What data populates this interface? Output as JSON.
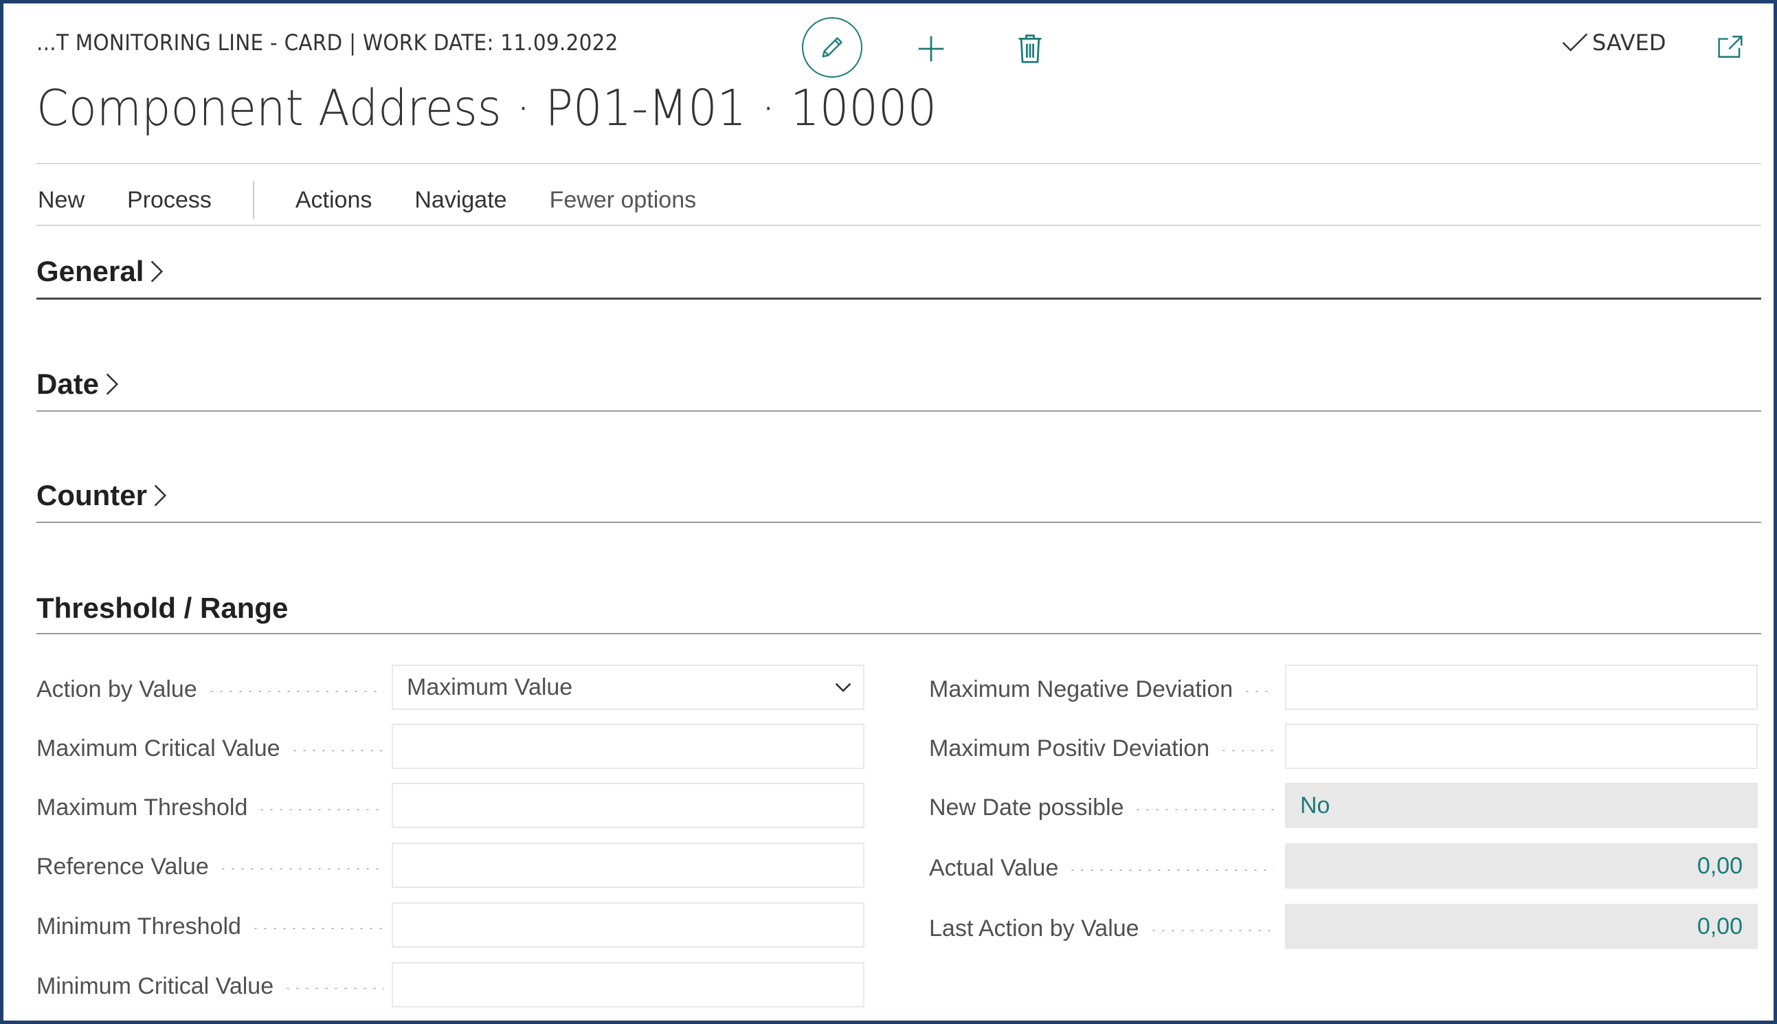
{
  "header": {
    "breadcrumb": "...T MONITORING LINE - CARD | WORK DATE: 11.09.2022",
    "title": "Component Address · P01-M01 · 10000",
    "saved_label": "SAVED"
  },
  "toolbar_icons": [
    "pencil-icon",
    "plus-icon",
    "trash-icon",
    "check-icon",
    "open-in-new-window-icon"
  ],
  "action_bar": {
    "items": [
      "New",
      "Process",
      "Actions",
      "Navigate",
      "Fewer options"
    ]
  },
  "sections": {
    "general": "General",
    "date": "Date",
    "counter": "Counter",
    "threshold": "Threshold / Range"
  },
  "threshold_left": [
    {
      "label": "Action by Value",
      "value": "Maximum Value"
    },
    {
      "label": "Maximum Critical Value",
      "value": ""
    },
    {
      "label": "Maximum Threshold",
      "value": ""
    },
    {
      "label": "Reference Value",
      "value": ""
    },
    {
      "label": "Minimum Threshold",
      "value": ""
    },
    {
      "label": "Minimum Critical Value",
      "value": ""
    }
  ],
  "threshold_right": [
    {
      "label": "Maximum Negative Deviation",
      "value": ""
    },
    {
      "label": "Maximum Positiv Deviation",
      "value": ""
    },
    {
      "label": "New Date possible",
      "value": "No"
    },
    {
      "label": "Actual Value",
      "value": "0,00"
    },
    {
      "label": "Last Action by Value",
      "value": "0,00"
    }
  ],
  "colors": {
    "accent": "#1b7b7a",
    "frame": "#1f3f6e",
    "readonly_bg": "#e8e8e8"
  }
}
